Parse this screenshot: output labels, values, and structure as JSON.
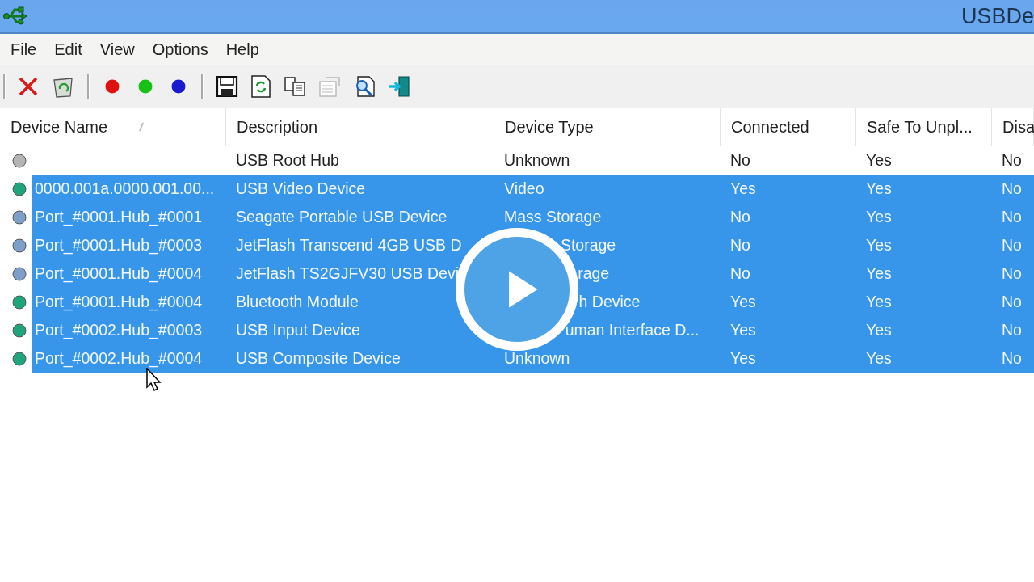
{
  "window": {
    "title": "USBDe"
  },
  "menu": [
    "File",
    "Edit",
    "View",
    "Options",
    "Help"
  ],
  "toolbar": [
    {
      "kind": "delete"
    },
    {
      "kind": "recycle"
    },
    {
      "kind": "separator"
    },
    {
      "kind": "dot",
      "color": "#e01010"
    },
    {
      "kind": "dot",
      "color": "#18c018"
    },
    {
      "kind": "dot",
      "color": "#1a1ad0"
    },
    {
      "kind": "separator"
    },
    {
      "kind": "save"
    },
    {
      "kind": "refresh"
    },
    {
      "kind": "copy"
    },
    {
      "kind": "properties",
      "disabled": true
    },
    {
      "kind": "find"
    },
    {
      "kind": "exit"
    }
  ],
  "table": {
    "columns": [
      {
        "label": "Device Name",
        "sorted": true
      },
      {
        "label": "Description",
        "sorted": false
      },
      {
        "label": "Device Type",
        "sorted": false
      },
      {
        "label": "Connected",
        "sorted": false
      },
      {
        "label": "Safe To Unpl...",
        "sorted": false
      },
      {
        "label": "Disa",
        "sorted": false
      }
    ],
    "rows": [
      {
        "color": "#b4b4b4",
        "selected": false,
        "cells": [
          "",
          "USB Root Hub",
          "Unknown",
          "No",
          "Yes",
          "No"
        ]
      },
      {
        "color": "#1fa47c",
        "selected": true,
        "cells": [
          "0000.001a.0000.001.00...",
          "USB Video Device",
          "Video",
          "Yes",
          "Yes",
          "No"
        ]
      },
      {
        "color": "#7f9fcb",
        "selected": true,
        "cells": [
          "Port_#0001.Hub_#0001",
          "Seagate Portable USB Device",
          "Mass Storage",
          "No",
          "Yes",
          "No"
        ]
      },
      {
        "color": "#7f9fcb",
        "selected": true,
        "cells": [
          "Port_#0001.Hub_#0003",
          "JetFlash Transcend 4GB USB D",
          "Storage",
          "No",
          "Yes",
          "No"
        ]
      },
      {
        "color": "#7f9fcb",
        "selected": true,
        "cells": [
          "Port_#0001.Hub_#0004",
          "JetFlash TS2GJFV30 USB Devi",
          "rage",
          "No",
          "Yes",
          "No"
        ]
      },
      {
        "color": "#1fa47c",
        "selected": true,
        "cells": [
          "Port_#0001.Hub_#0004",
          "Bluetooth Module",
          "h Device",
          "Yes",
          "Yes",
          "No"
        ]
      },
      {
        "color": "#1fa47c",
        "selected": true,
        "cells": [
          "Port_#0002.Hub_#0003",
          "USB Input Device",
          "uman Interface D...",
          "Yes",
          "Yes",
          "No"
        ]
      },
      {
        "color": "#1fa47c",
        "selected": true,
        "cells": [
          "Port_#0002.Hub_#0004",
          "USB Composite Device",
          "Unknown",
          "Yes",
          "Yes",
          "No"
        ]
      }
    ]
  },
  "player": {
    "paused": true
  }
}
